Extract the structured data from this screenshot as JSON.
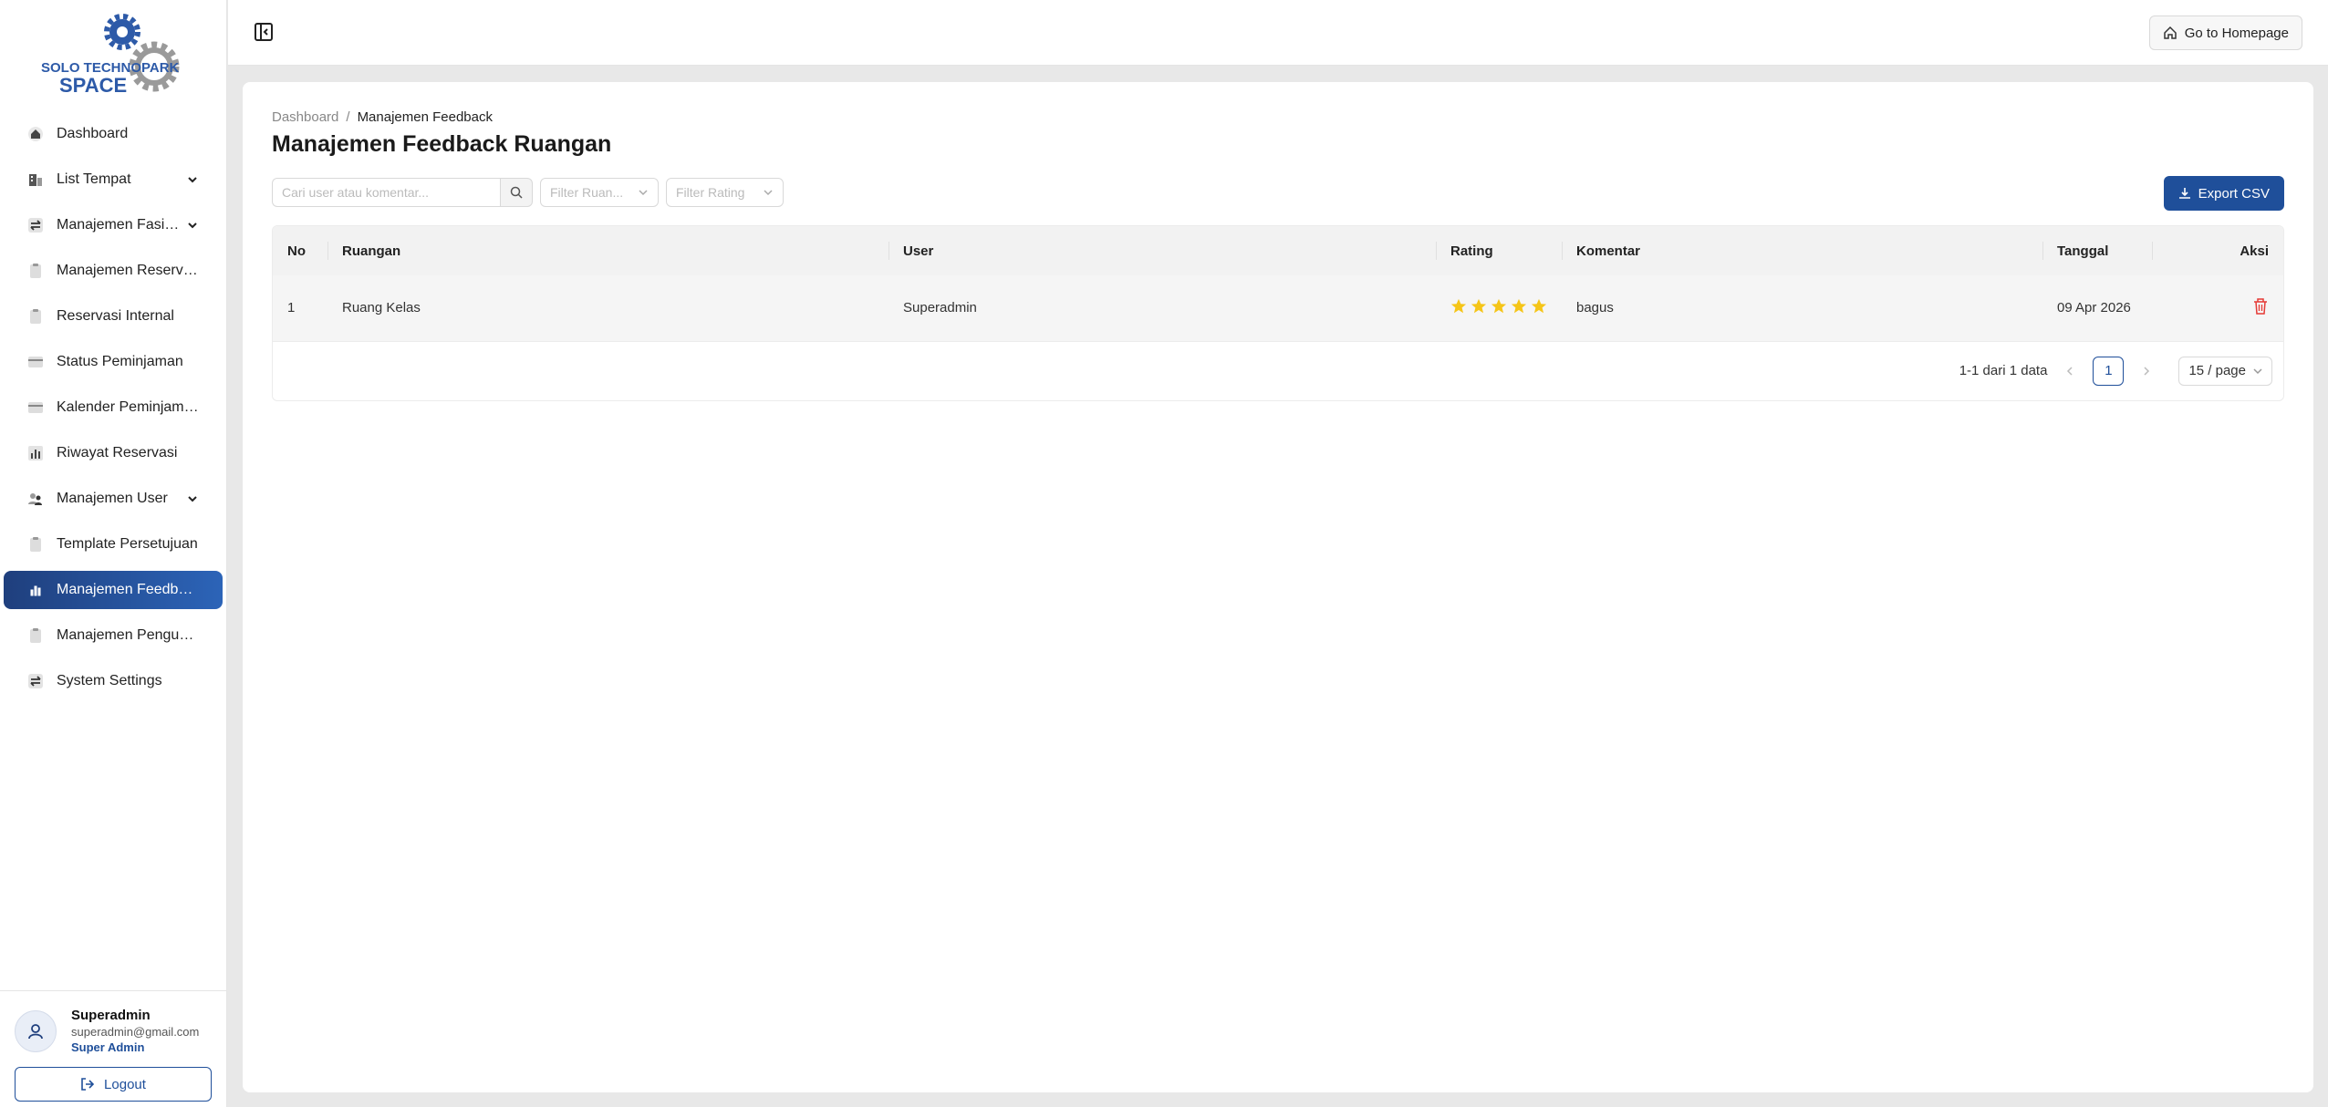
{
  "logo": {
    "line1": "SOLO TECHNOPARK",
    "line2": "SPACE"
  },
  "sidebar": {
    "items": [
      {
        "label": "Dashboard",
        "icon": "home-icon",
        "expandable": false,
        "active": false
      },
      {
        "label": "List Tempat",
        "icon": "building-icon",
        "expandable": true,
        "active": false
      },
      {
        "label": "Manajemen Fasilitas",
        "icon": "swap-icon",
        "expandable": true,
        "active": false
      },
      {
        "label": "Manajemen Reservasi",
        "icon": "clipboard-icon",
        "expandable": false,
        "active": false
      },
      {
        "label": "Reservasi Internal",
        "icon": "clipboard-icon",
        "expandable": false,
        "active": false
      },
      {
        "label": "Status Peminjaman",
        "icon": "card-icon",
        "expandable": false,
        "active": false
      },
      {
        "label": "Kalender Peminjaman",
        "icon": "card-icon",
        "expandable": false,
        "active": false
      },
      {
        "label": "Riwayat Reservasi",
        "icon": "bar-chart-icon",
        "expandable": false,
        "active": false
      },
      {
        "label": "Manajemen User",
        "icon": "users-icon",
        "expandable": true,
        "active": false
      },
      {
        "label": "Template Persetujuan",
        "icon": "clipboard-icon",
        "expandable": false,
        "active": false
      },
      {
        "label": "Manajemen Feedback",
        "icon": "bar-chart-icon",
        "expandable": false,
        "active": true
      },
      {
        "label": "Manajemen Pengumu...",
        "icon": "clipboard-icon",
        "expandable": false,
        "active": false
      },
      {
        "label": "System Settings",
        "icon": "swap-icon",
        "expandable": false,
        "active": false
      }
    ]
  },
  "user": {
    "name": "Superadmin",
    "email": "superadmin@gmail.com",
    "role": "Super Admin",
    "logout_label": "Logout"
  },
  "topbar": {
    "home_label": "Go to Homepage"
  },
  "breadcrumb": {
    "root": "Dashboard",
    "separator": "/",
    "current": "Manajemen Feedback"
  },
  "page": {
    "title": "Manajemen Feedback Ruangan"
  },
  "filters": {
    "search_placeholder": "Cari user atau komentar...",
    "room_placeholder": "Filter Ruan...",
    "rating_placeholder": "Filter Rating",
    "export_label": "Export CSV"
  },
  "table": {
    "headers": {
      "no": "No",
      "ruangan": "Ruangan",
      "user": "User",
      "rating": "Rating",
      "komentar": "Komentar",
      "tanggal": "Tanggal",
      "aksi": "Aksi"
    },
    "rows": [
      {
        "no": "1",
        "ruangan": "Ruang Kelas",
        "user": "Superadmin",
        "rating": 5,
        "komentar": "bagus",
        "tanggal": "09 Apr 2026"
      }
    ]
  },
  "pagination": {
    "summary": "1-1 dari 1 data",
    "current_page": "1",
    "page_size": "15 / page"
  },
  "colors": {
    "primary": "#1f4f9a",
    "star": "#f5c518",
    "delete": "#e53935"
  }
}
